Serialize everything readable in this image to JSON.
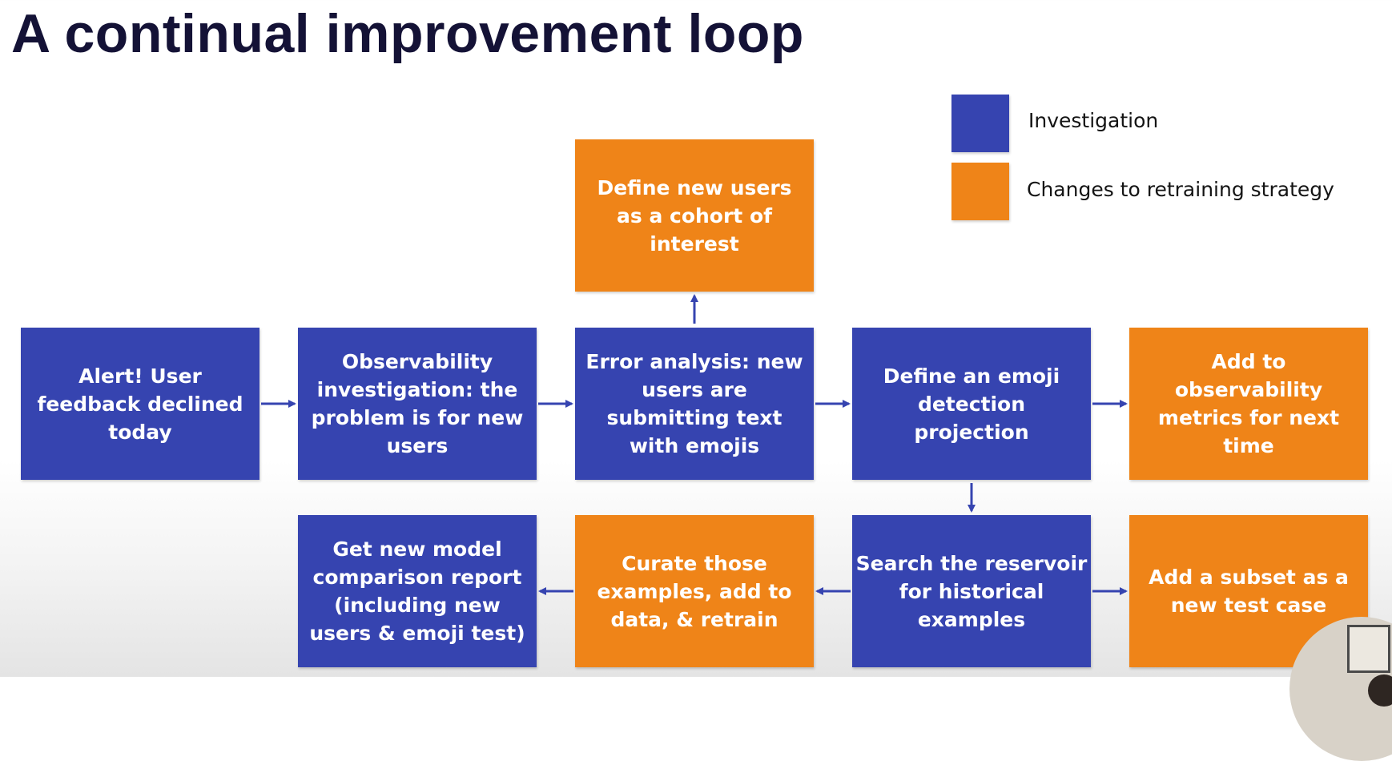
{
  "title": "A continual improvement loop",
  "legend": {
    "investigation": {
      "label": "Investigation",
      "color": "#3644b0"
    },
    "retraining": {
      "label": "Changes to retraining strategy",
      "color": "#ef8418"
    }
  },
  "boxes": {
    "alert": "Alert! User feedback declined today",
    "observability": "Observability investigation: the problem is for new users",
    "error_analysis": "Error analysis: new users are submitting text with emojis",
    "emoji_projection": "Define an emoji detection projection",
    "add_metrics": "Add to observability metrics for next time",
    "cohort": "Define new users as a cohort of interest",
    "search_reservoir": "Search the reservoir for historical examples",
    "curate": "Curate those examples, add to data, & retrain",
    "comparison_report": "Get new model comparison report (including new users & emoji test)",
    "test_case": "Add a subset as a new test case"
  }
}
